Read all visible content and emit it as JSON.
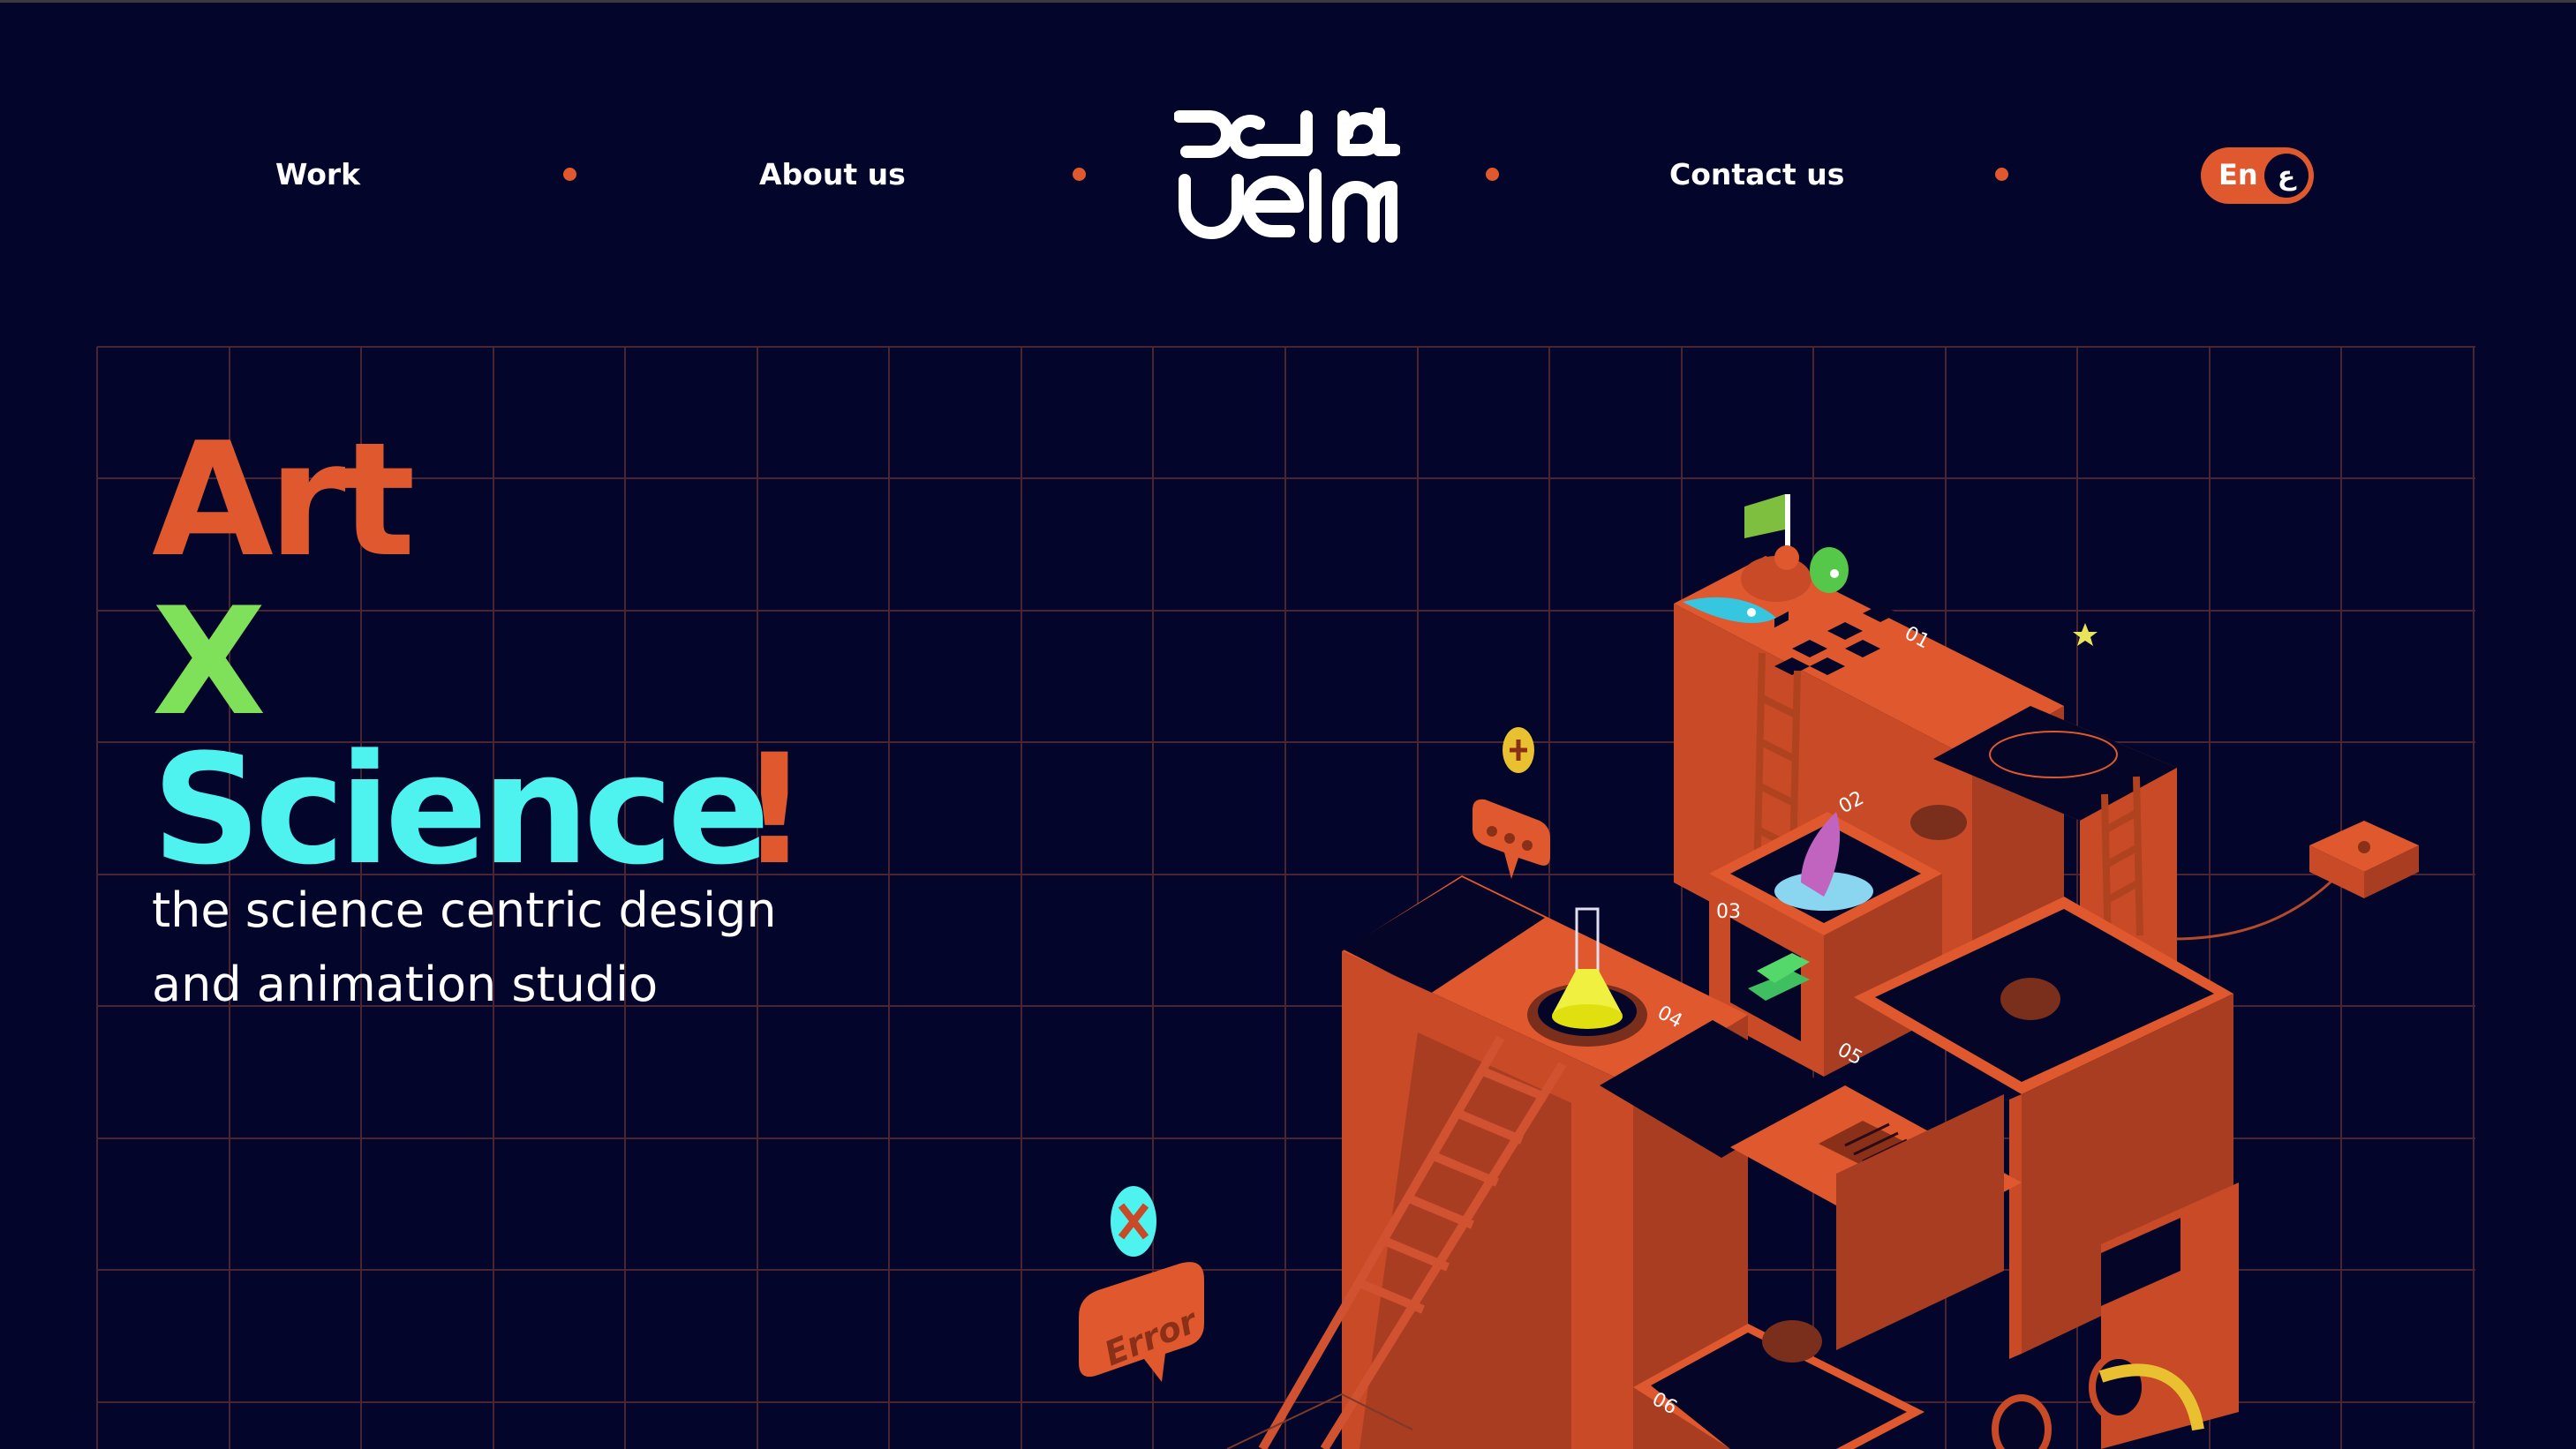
{
  "nav": {
    "work": "Work",
    "about": "About us",
    "contact": "Contact us",
    "lang_en": "En",
    "lang_ar": "ع"
  },
  "logo": {
    "arabic_text": "علم",
    "latin_text": "3elm"
  },
  "hero": {
    "word_art": "Art",
    "word_x": "X",
    "word_science": "Science",
    "exclaim": "!",
    "tagline_line1": "the science centric design",
    "tagline_line2": "and animation studio"
  },
  "illustration": {
    "step_labels": [
      "01",
      "02",
      "03",
      "04",
      "05",
      "06"
    ],
    "error_label": "Error"
  },
  "colors": {
    "background": "#03052a",
    "accent_orange": "#e0582e",
    "green": "#7fe05a",
    "cyan": "#4ef3f0",
    "grid_line": "#5a2a2e"
  },
  "icons": [
    "chat-bubble-icon",
    "error-bubble-icon",
    "plus-coin-icon",
    "close-coin-icon",
    "star-icon",
    "flag-icon"
  ]
}
